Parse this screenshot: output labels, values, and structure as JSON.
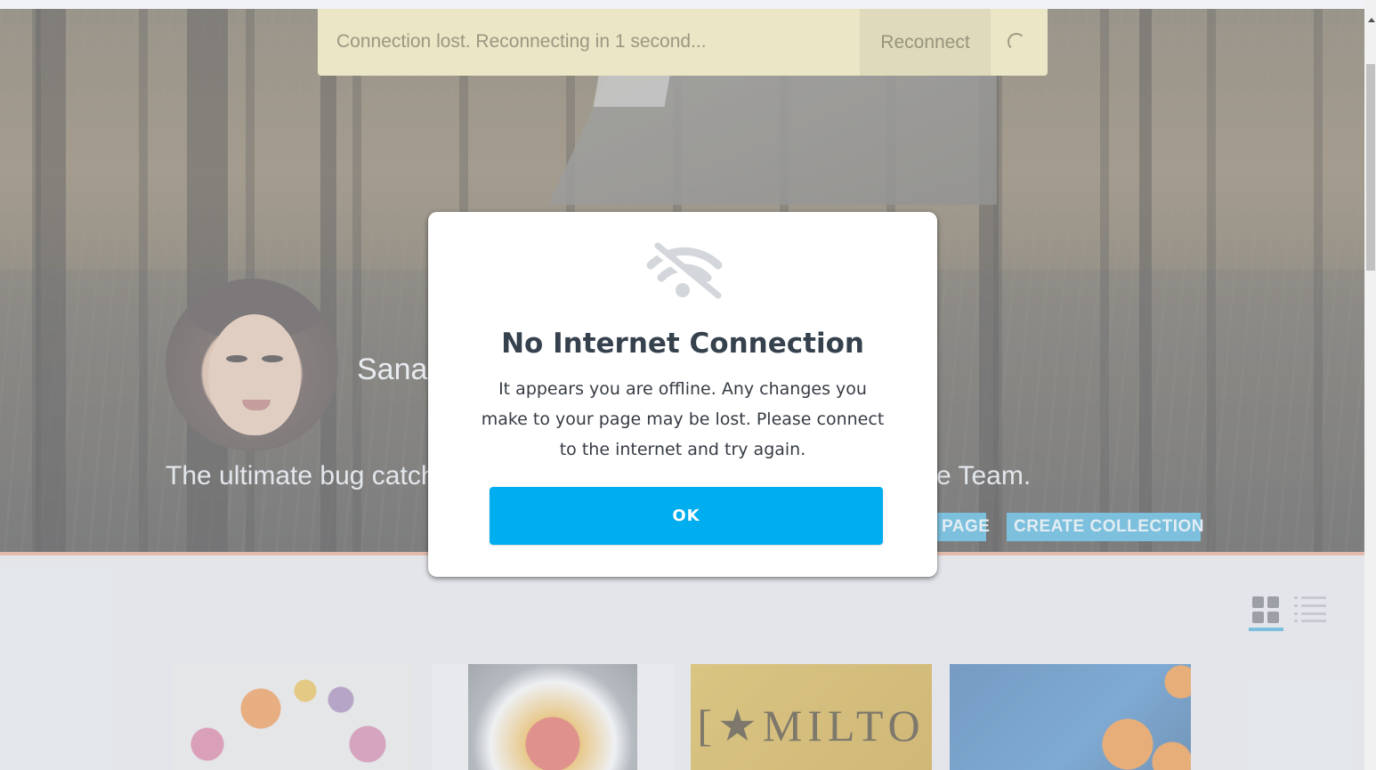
{
  "connection_banner": {
    "message": "Connection lost. Reconnecting in 1 second...",
    "reconnect_label": "Reconnect",
    "spinner_icon": "loading-spinner-icon"
  },
  "profile": {
    "name_visible": "Sanak",
    "tagline_left": "The ultimate bug catch",
    "tagline_right": "e Team.",
    "page_button_label": "PAGE",
    "create_collection_label": "CREATE COLLECTION"
  },
  "content": {
    "view_toggles": [
      {
        "icon": "grid-view-icon",
        "active": true
      },
      {
        "icon": "list-view-icon",
        "active": false
      }
    ],
    "card_3_text": "[★MILTO"
  },
  "modal": {
    "icon": "wifi-off-icon",
    "title": "No Internet Connection",
    "body": "It appears you are offline. Any changes you make to your page may be lost. Please connect to the internet and try again.",
    "ok_label": "OK"
  },
  "colors": {
    "accent": "#00adee",
    "banner_bg": "#ebe6c5",
    "title_text": "#36414e"
  }
}
